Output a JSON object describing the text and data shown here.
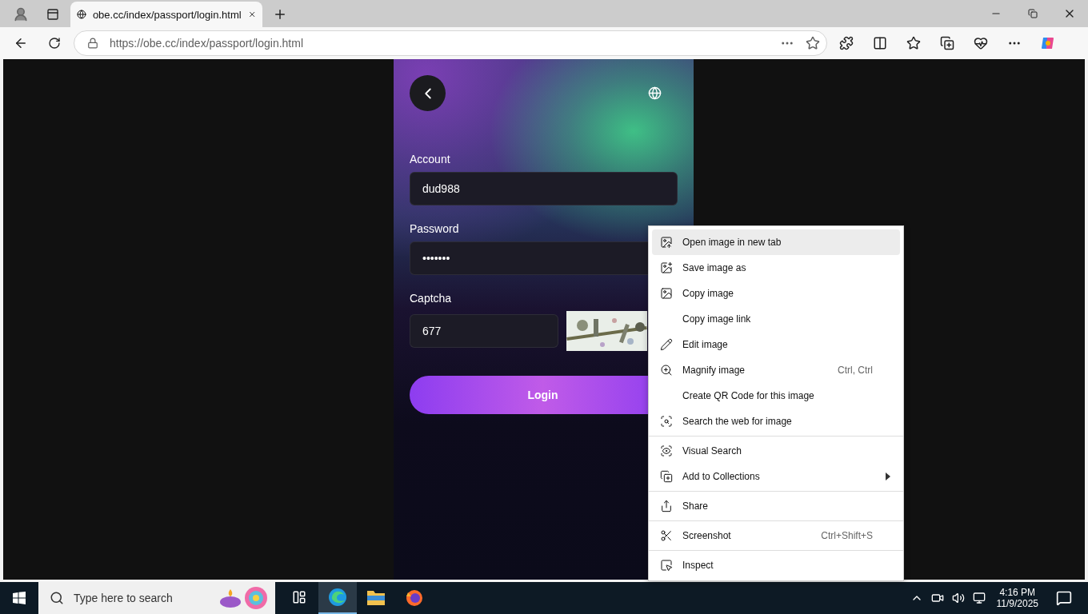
{
  "browser": {
    "tabs": [
      {
        "title": "obe.cc/index/passport/login.html",
        "selected": true
      }
    ],
    "url": "https://obe.cc/index/passport/login.html"
  },
  "login": {
    "fields": [
      {
        "kind": "text",
        "label": "Account",
        "value": "dud988"
      },
      {
        "kind": "text",
        "label": "Password",
        "value": "•••••••"
      },
      {
        "kind": "captcha",
        "label": "Captcha",
        "value": "677"
      }
    ],
    "button": "Login"
  },
  "context_menu": {
    "groups": [
      [
        {
          "label": "Open image in new tab",
          "selected": true
        },
        {
          "label": "Save image as",
          "selected": false
        },
        {
          "label": "Copy image",
          "selected": false
        },
        {
          "label": "Copy image link",
          "selected": false
        },
        {
          "label": "Edit image",
          "selected": false
        },
        {
          "label": "Magnify image",
          "shortcut": "Ctrl, Ctrl",
          "selected": false
        },
        {
          "label": "Create QR Code for this image",
          "selected": false
        },
        {
          "label": "Search the web for image",
          "selected": false
        }
      ],
      [
        {
          "label": "Visual Search",
          "selected": false
        },
        {
          "label": "Add to Collections",
          "submenu": true,
          "selected": false
        }
      ],
      [
        {
          "label": "Share",
          "selected": false
        }
      ],
      [
        {
          "label": "Screenshot",
          "shortcut": "Ctrl+Shift+S",
          "selected": false
        }
      ],
      [
        {
          "label": "Inspect",
          "selected": false
        }
      ]
    ]
  },
  "taskbar": {
    "search": {
      "placeholder": "Type here to search"
    },
    "apps": [
      {
        "selected": false
      },
      {
        "selected": true
      },
      {
        "selected": false
      },
      {
        "selected": false
      }
    ],
    "time": "4:16 PM",
    "date": "11/9/2025"
  }
}
